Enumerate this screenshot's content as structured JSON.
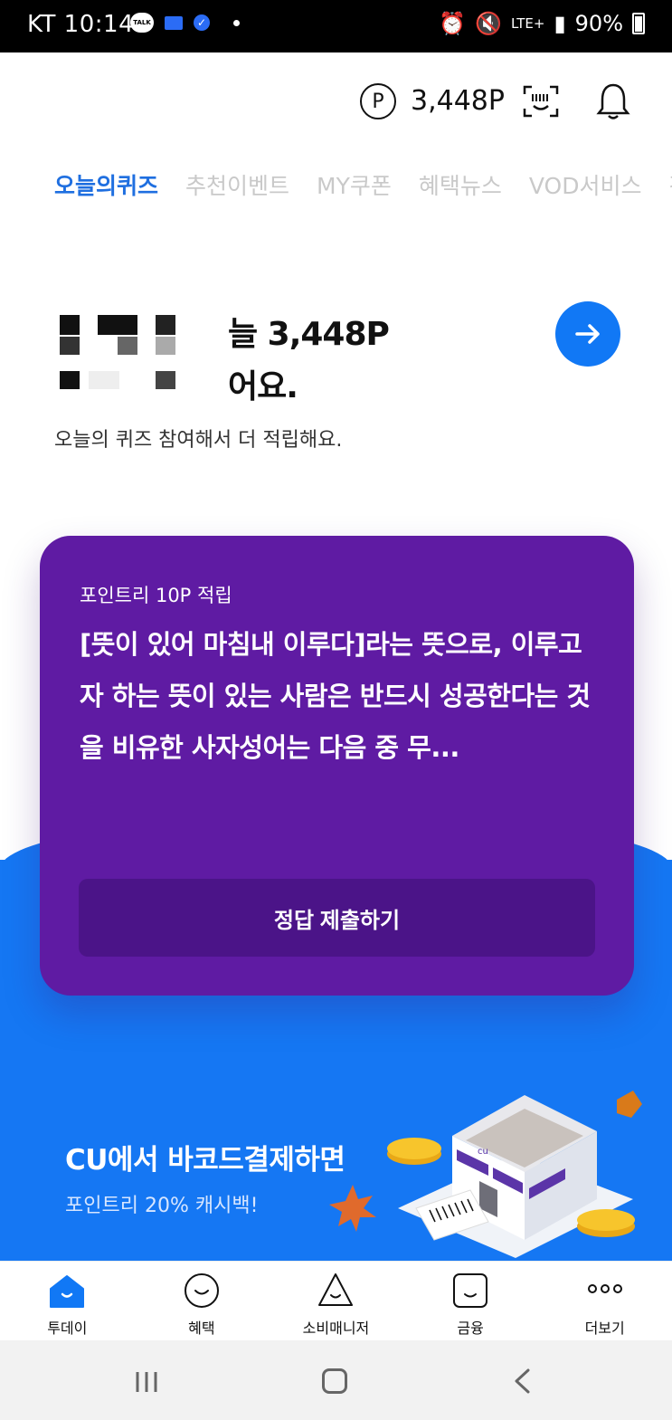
{
  "status_bar": {
    "carrier_time": "KT 10:14",
    "talk_label": "TALK",
    "network": "LTE+",
    "battery": "90%"
  },
  "header": {
    "point_symbol": "P",
    "point_value": "3,448P"
  },
  "tabs": [
    {
      "label": "오늘의퀴즈",
      "active": true
    },
    {
      "label": "추천이벤트",
      "active": false
    },
    {
      "label": "MY쿠폰",
      "active": false
    },
    {
      "label": "혜택뉴스",
      "active": false
    },
    {
      "label": "VOD서비스",
      "active": false
    },
    {
      "label": "간",
      "active": false
    }
  ],
  "summary": {
    "line1": "늘 3,448P",
    "line2": "어요.",
    "subtitle": "오늘의 퀴즈 참여해서 더 적립해요."
  },
  "quiz": {
    "tag": "포인트리 10P 적립",
    "question": "[뜻이 있어 마침내 이루다]라는 뜻으로, 이루고자 하는 뜻이 있는 사람은 반드시 성공한다는 것을 비유한 사자성어는 다음 중 무...",
    "submit_label": "정답 제출하기",
    "card_color": "#5f1ba3"
  },
  "banner": {
    "title": "CU에서 바코드결제하면",
    "subtitle": "포인트리 20% 캐시백!",
    "store_label": "cu",
    "background_color": "#1577f3"
  },
  "bottom_nav": [
    {
      "label": "투데이",
      "icon": "home-face-icon",
      "active": true
    },
    {
      "label": "혜택",
      "icon": "smile-circle-icon",
      "active": false
    },
    {
      "label": "소비매니저",
      "icon": "triangle-face-icon",
      "active": false
    },
    {
      "label": "금융",
      "icon": "square-face-icon",
      "active": false
    },
    {
      "label": "더보기",
      "icon": "more-dots-icon",
      "active": false
    }
  ],
  "accent_color": "#1178f5"
}
